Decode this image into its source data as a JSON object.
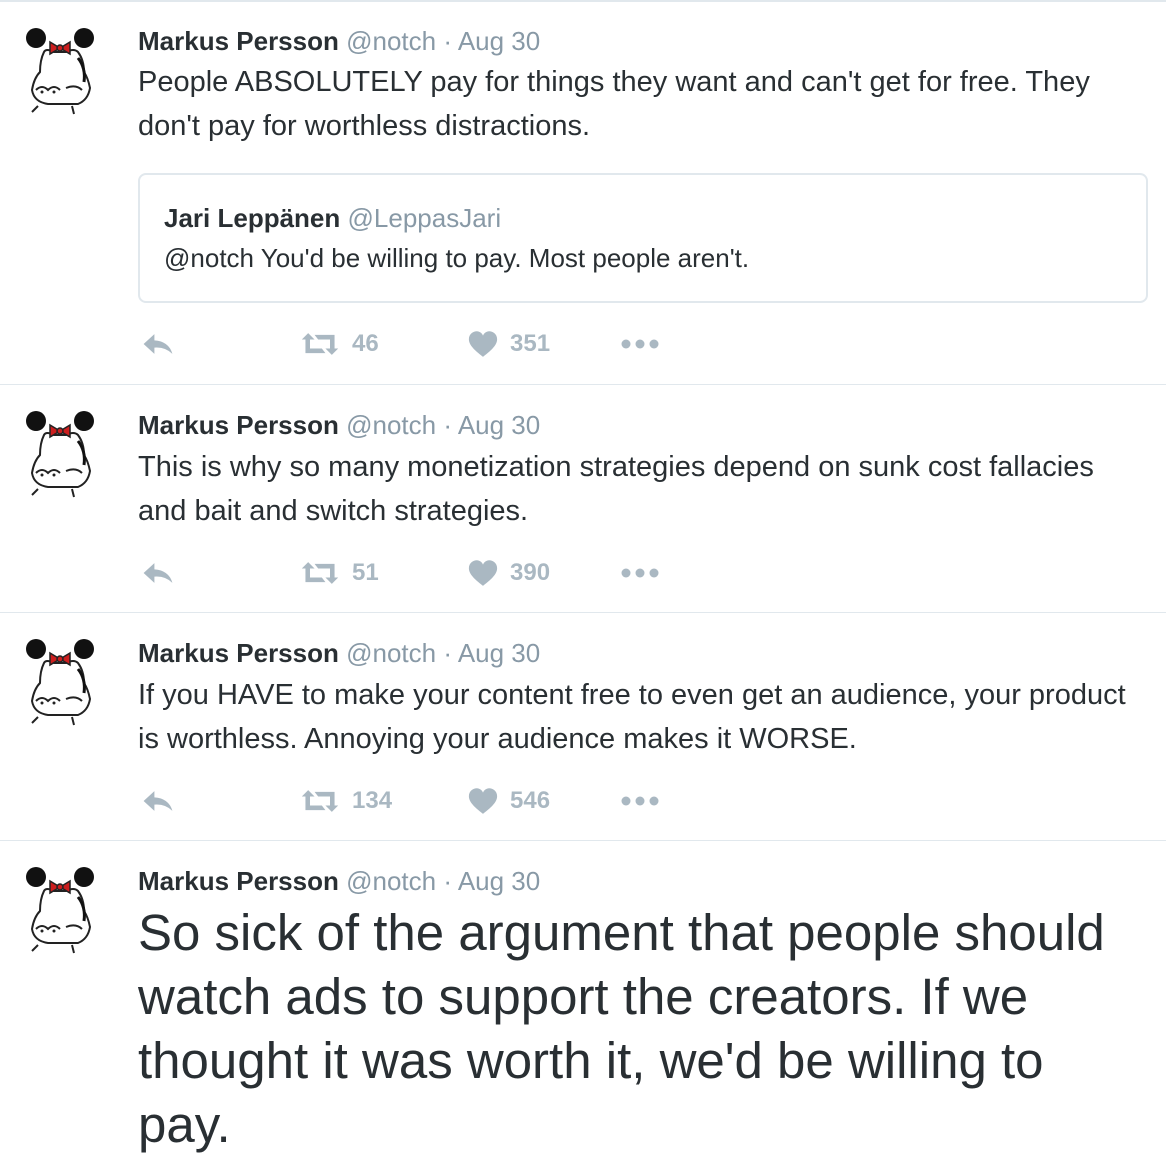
{
  "tweets": [
    {
      "name": "Markus Persson",
      "handle": "@notch",
      "separator": "·",
      "date": "Aug 30",
      "text": "People ABSOLUTELY pay for things they want and can't get for free. They don't pay for worthless distractions.",
      "quote": {
        "name": "Jari Leppänen",
        "handle": "@LeppasJari",
        "text": "@notch You'd be willing to pay. Most people aren't."
      },
      "retweets": "46",
      "likes": "351"
    },
    {
      "name": "Markus Persson",
      "handle": "@notch",
      "separator": "·",
      "date": "Aug 30",
      "text": "This is why so many monetization strategies depend on sunk cost fallacies and bait and switch strategies.",
      "retweets": "51",
      "likes": "390"
    },
    {
      "name": "Markus Persson",
      "handle": "@notch",
      "separator": "·",
      "date": "Aug 30",
      "text": "If you HAVE to make your content free to even get an audience, your product is worthless. Annoying your audience makes it WORSE.",
      "retweets": "134",
      "likes": "546"
    },
    {
      "name": "Markus Persson",
      "handle": "@notch",
      "separator": "·",
      "date": "Aug 30",
      "text": "So sick of the argument that people should watch ads to support the creators. If we thought it was worth it, we'd be willing to pay."
    }
  ],
  "icons": {
    "avatar": "cartoon-avatar-with-red-bow",
    "reply": "reply-arrow-icon",
    "retweet": "retweet-icon",
    "like": "heart-icon",
    "more": "more-dots-icon"
  },
  "colors": {
    "text": "#292f33",
    "meta": "#8899a6",
    "action": "#aab8c2",
    "border": "#e1e8ed",
    "bow": "#cc1f1f"
  }
}
